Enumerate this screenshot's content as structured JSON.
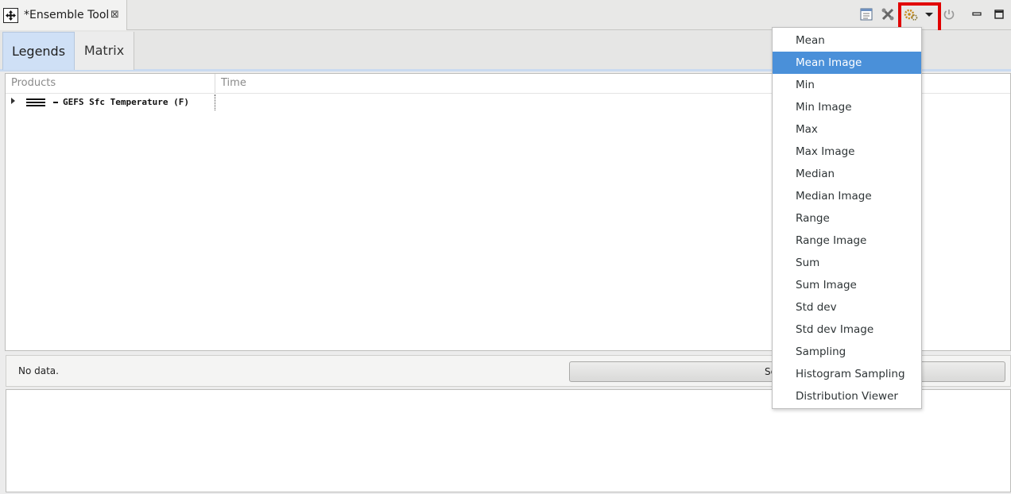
{
  "view": {
    "title": "*Ensemble Tool",
    "close_glyph": "⊠",
    "toolbar_icons": [
      "notes-icon",
      "tools-icon",
      "gear-icon",
      "menu-dropdown-icon",
      "power-icon",
      "minimize-icon",
      "maximize-icon"
    ]
  },
  "tabs": [
    {
      "label": "Legends",
      "active": true
    },
    {
      "label": "Matrix",
      "active": false
    }
  ],
  "table": {
    "columns": [
      "Products",
      "Time"
    ],
    "rows": [
      {
        "product": "GEFS Sfc Temperature (F)",
        "time": ""
      }
    ]
  },
  "status": {
    "message": "No data.",
    "button_label": "Se"
  },
  "menu": {
    "items": [
      "Mean",
      "Mean Image",
      "Min",
      "Min Image",
      "Max",
      "Max Image",
      "Median",
      "Median Image",
      "Range",
      "Range Image",
      "Sum",
      "Sum Image",
      "Std dev",
      "Std dev Image",
      "Sampling",
      "Histogram Sampling",
      "Distribution Viewer"
    ],
    "selected_index": 1
  },
  "colors": {
    "menu_highlight": "#4a90d9",
    "active_tab": "#cfe0f6",
    "callout_box": "#e10000"
  }
}
